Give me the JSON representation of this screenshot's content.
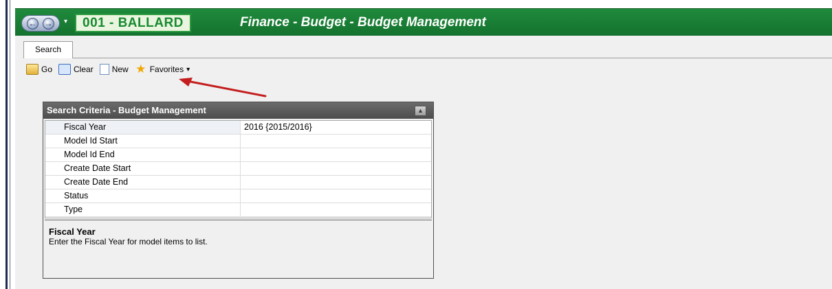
{
  "titlebar": {
    "entity": "001 - BALLARD",
    "title": "Finance - Budget - Budget Management",
    "back_glyph": "←",
    "forward_glyph": "→",
    "dropdown_glyph": "▾"
  },
  "tabs": [
    {
      "label": "Search"
    }
  ],
  "toolbar": {
    "go_label": "Go",
    "clear_label": "Clear",
    "new_label": "New",
    "favorites_label": "Favorites",
    "favorites_caret": "▾",
    "star_glyph": "★"
  },
  "annotation": {
    "arrow_color": "#c41e1e"
  },
  "panel": {
    "title": "Search Criteria - Budget Management",
    "collapse_glyph": "▲",
    "rows": [
      {
        "label": "Fiscal Year",
        "value": "2016 {2015/2016}"
      },
      {
        "label": "Model Id Start",
        "value": ""
      },
      {
        "label": "Model Id End",
        "value": ""
      },
      {
        "label": "Create Date Start",
        "value": ""
      },
      {
        "label": "Create Date End",
        "value": ""
      },
      {
        "label": "Status",
        "value": ""
      },
      {
        "label": "Type",
        "value": ""
      }
    ],
    "help": {
      "title": "Fiscal Year",
      "text": "Enter the Fiscal Year for model items  to list."
    }
  },
  "colors": {
    "titlebar_green": "#1f8a3c",
    "entity_text": "#178a2f",
    "panel_header": "#5a5a5a"
  }
}
